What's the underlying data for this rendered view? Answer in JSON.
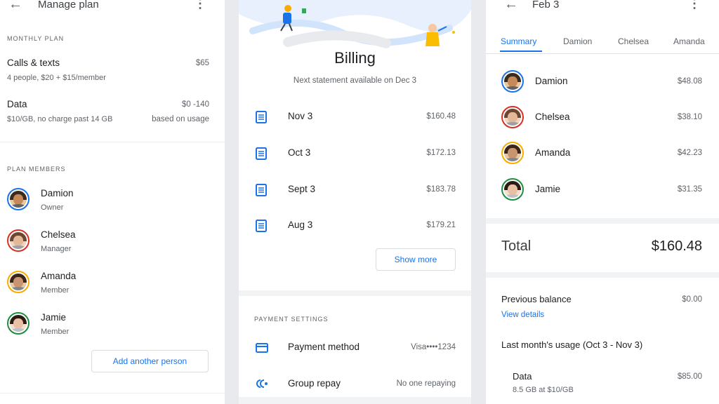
{
  "manage": {
    "title": "Manage plan",
    "monthly_plan_heading": "MONTHLY PLAN",
    "calls": {
      "label": "Calls & texts",
      "detail": "4 people, $20 + $15/member",
      "amount": "$65"
    },
    "data": {
      "label": "Data",
      "detail": "$10/GB, no charge past 14 GB",
      "amount": "$0 -140",
      "note": "based on usage"
    },
    "members_heading": "PLAN MEMBERS",
    "members": [
      {
        "name": "Damion",
        "role": "Owner",
        "ring": "#1a73e8"
      },
      {
        "name": "Chelsea",
        "role": "Manager",
        "ring": "#d93025"
      },
      {
        "name": "Amanda",
        "role": "Member",
        "ring": "#f9ab00"
      },
      {
        "name": "Jamie",
        "role": "Member",
        "ring": "#1e8e3e"
      }
    ],
    "add_button": "Add another person"
  },
  "billing": {
    "title": "Billing",
    "next_statement": "Next statement available on Dec 3",
    "statements": [
      {
        "date": "Nov 3",
        "amount": "$160.48"
      },
      {
        "date": "Oct 3",
        "amount": "$172.13"
      },
      {
        "date": "Sept 3",
        "amount": "$183.78"
      },
      {
        "date": "Aug 3",
        "amount": "$179.21"
      }
    ],
    "show_more": "Show more",
    "payment_heading": "PAYMENT SETTINGS",
    "payment_method": {
      "label": "Payment method",
      "value": "Visa••••1234"
    },
    "group_repay": {
      "label": "Group repay",
      "value": "No one repaying"
    }
  },
  "statement": {
    "title": "Feb 3",
    "tabs": [
      "Summary",
      "Damion",
      "Chelsea",
      "Amanda"
    ],
    "people": [
      {
        "name": "Damion",
        "amount": "$48.08",
        "ring": "#1a73e8"
      },
      {
        "name": "Chelsea",
        "amount": "$38.10",
        "ring": "#d93025"
      },
      {
        "name": "Amanda",
        "amount": "$42.23",
        "ring": "#f9ab00"
      },
      {
        "name": "Jamie",
        "amount": "$31.35",
        "ring": "#1e8e3e"
      }
    ],
    "total_label": "Total",
    "total_amount": "$160.48",
    "previous_balance": {
      "label": "Previous balance",
      "amount": "$0.00",
      "link": "View details"
    },
    "usage_heading": "Last month's usage (Oct 3 - Nov 3)",
    "usage_item": {
      "label": "Data",
      "detail": "8.5 GB at $10/GB",
      "amount": "$85.00"
    }
  },
  "colors": {
    "accent": "#1a73e8",
    "text": "#202124",
    "secondary": "#5f6368"
  }
}
